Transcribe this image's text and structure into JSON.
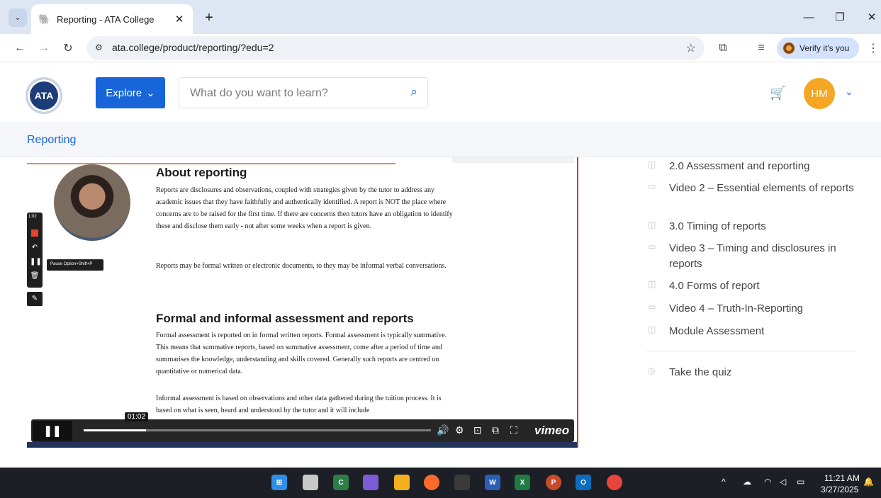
{
  "browser": {
    "tab_title": "Reporting - ATA College",
    "tab_favicon": "🐘",
    "tab_close": "✕",
    "tab_list": "⌄",
    "new_tab": "+",
    "minimize": "—",
    "restore": "❐",
    "close": "✕",
    "back": "←",
    "forward": "→",
    "reload": "↻",
    "site_info": "⚙",
    "url": "ata.college/product/reporting/?edu=2",
    "star": "☆",
    "extensions": "⧉",
    "reading": "≡",
    "verify_label": "Verify it's you",
    "menu": "⋮"
  },
  "header": {
    "logo_text": "ATA",
    "explore_label": "Explore",
    "explore_chevron": "⌄",
    "search_placeholder": "What do you want to learn?",
    "search_icon": "⌕",
    "cart_icon": "🛒",
    "avatar_initials": "HM",
    "avatar_chevron": "⌄"
  },
  "breadcrumb": "Reporting",
  "video": {
    "about_heading": "About reporting",
    "about_p1": "Reports are disclosures and observations, coupled with strategies given by the tutor to address any academic issues that they have faithfully and authentically identified. A report is NOT the place where concerns are to be raised for the first time. If there are concerns then tutors have an obligation to identify these and disclose them early - not after some weeks when a report is given.",
    "about_p2": "Reports may be formal written or electronic documents, to they may be informal verbal conversations.",
    "formal_heading": "Formal and informal assessment and reports",
    "formal_p1": "Formal assessment is reported on in formal written reports. Formal assessment is typically summative. This means that summative reports, based on summative assessment, come after a period of time and summarises the knowledge, understanding and skills covered. Generally such reports are centred on quantitative or numerical data.",
    "formal_p2": "Informal assessment is based on observations and other data gathered during the tuition process. It is based on what is seen, heard and understood by the tutor and it will include",
    "recorder_time": "1:02",
    "recorder_tooltip": "Pause  Option+Shift+P",
    "timecode": "01:02",
    "progress_fraction": 0.18,
    "play_pause": "❚❚",
    "volume": "🔊",
    "settings": "⚙",
    "cast": "⊡",
    "pip": "⧉",
    "fullscreen": "⛶",
    "brand": "vimeo"
  },
  "outline": {
    "items": [
      {
        "icon": "◫",
        "text": "2.0      Assessment and reporting"
      },
      {
        "icon": "▭",
        "text": "Video 2 – Essential elements of reports"
      },
      {
        "icon": "◫",
        "text": "3.0      Timing of reports"
      },
      {
        "icon": "▭",
        "text": "Video 3 – Timing and disclosures in reports"
      },
      {
        "icon": "◫",
        "text": "4.0      Forms of report"
      },
      {
        "icon": "▭",
        "text": "Video 4 – Truth-In-Reporting"
      },
      {
        "icon": "◫",
        "text": "Module Assessment"
      }
    ],
    "quiz_icon": "◷",
    "quiz_label": "Take the quiz"
  },
  "taskbar": {
    "time": "11:21 AM",
    "date": "3/27/2025",
    "tray_chevron": "^",
    "notification": "🔔"
  },
  "colors": {
    "accent": "#1765d8",
    "avatar": "#f5a623"
  }
}
